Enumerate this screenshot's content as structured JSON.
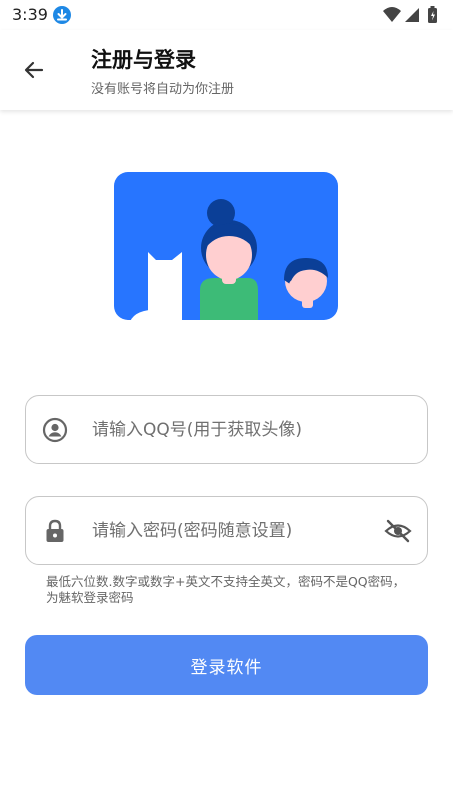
{
  "status_bar": {
    "time": "3:39",
    "icons": [
      "download-icon",
      "wifi-icon",
      "signal-icon",
      "battery-icon"
    ]
  },
  "header": {
    "back_icon": "arrow-left-icon",
    "title": "注册与登录",
    "subtitle": "没有账号将自动为你注册"
  },
  "illustration": {
    "background_color": "#2775ff"
  },
  "qq_field": {
    "icon": "user-circle-icon",
    "placeholder": "请输入QQ号(用于获取头像)",
    "value": ""
  },
  "password_field": {
    "icon": "lock-icon",
    "placeholder": "请输入密码(密码随意设置)",
    "value": "",
    "visibility_icon": "eye-off-icon"
  },
  "hint": "最低六位数.数字或数字+英文不支持全英文，密码不是QQ密码，为魅软登录密码",
  "login_button": {
    "label": "登录软件",
    "color": "#5289f3"
  }
}
